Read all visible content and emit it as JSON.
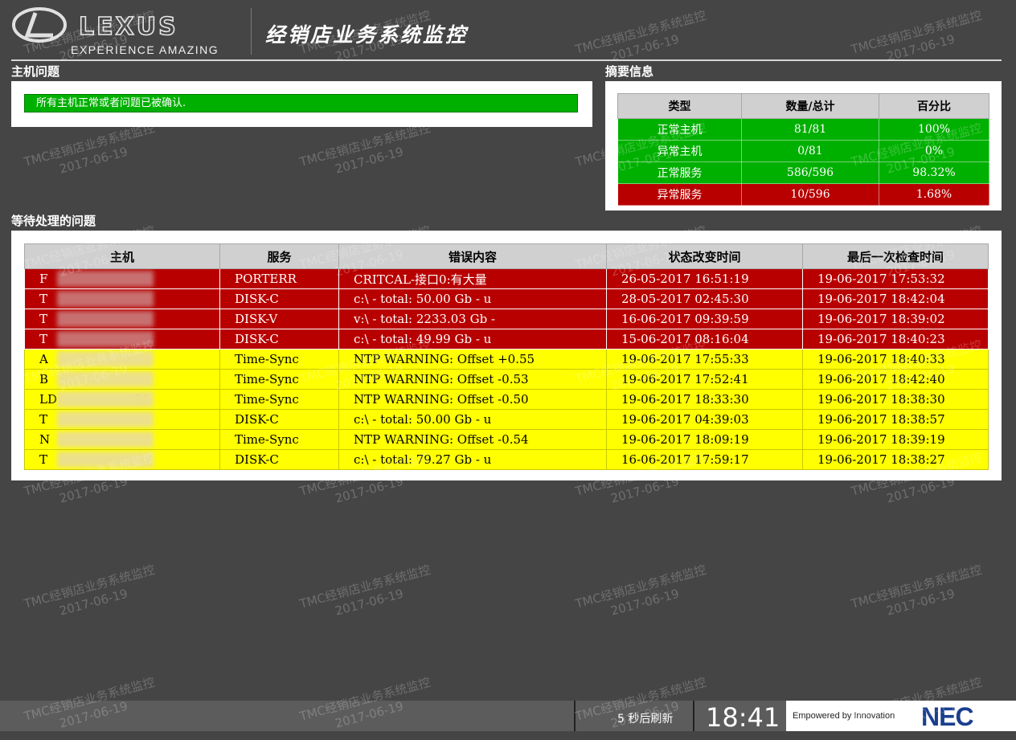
{
  "header": {
    "brand_word": "LEXUS",
    "brand_tagline": "EXPERIENCE AMAZING",
    "system_title": "经销店业务系统监控"
  },
  "host_issues": {
    "title": "主机问题",
    "status_message": "所有主机正常或者问题已被确认."
  },
  "summary": {
    "title": "摘要信息",
    "columns": [
      "类型",
      "数量/总计",
      "百分比"
    ],
    "rows": [
      {
        "type": "正常主机",
        "count": "81/81",
        "percent": "100%",
        "status": "green"
      },
      {
        "type": "异常主机",
        "count": "0/81",
        "percent": "0%",
        "status": "green"
      },
      {
        "type": "正常服务",
        "count": "586/596",
        "percent": "98.32%",
        "status": "green"
      },
      {
        "type": "异常服务",
        "count": "10/596",
        "percent": "1.68%",
        "status": "red"
      }
    ]
  },
  "pending": {
    "title": "等待处理的问题",
    "columns": [
      "主机",
      "服务",
      "错误内容",
      "状态改变时间",
      "最后一次检查时间"
    ],
    "rows": [
      {
        "host": "F",
        "service": "PORTERR",
        "error": "CRITCAL-接口0:有大量",
        "changed": "26-05-2017 16:51:19",
        "checked": "19-06-2017 17:53:32",
        "severity": "critical"
      },
      {
        "host": "T",
        "service": "DISK-C",
        "error": "c:\\ - total: 50.00 Gb - u",
        "changed": "28-05-2017 02:45:30",
        "checked": "19-06-2017 18:42:04",
        "severity": "critical"
      },
      {
        "host": "T",
        "service": "DISK-V",
        "error": "v:\\ - total: 2233.03 Gb -",
        "changed": "16-06-2017 09:39:59",
        "checked": "19-06-2017 18:39:02",
        "severity": "critical"
      },
      {
        "host": "T",
        "service": "DISK-C",
        "error": "c:\\ - total: 49.99 Gb - u",
        "changed": "15-06-2017 08:16:04",
        "checked": "19-06-2017 18:40:23",
        "severity": "critical"
      },
      {
        "host": "A",
        "service": "Time-Sync",
        "error": "NTP WARNING: Offset +0.55",
        "changed": "19-06-2017 17:55:33",
        "checked": "19-06-2017 18:40:33",
        "severity": "warning"
      },
      {
        "host": "B",
        "service": "Time-Sync",
        "error": "NTP WARNING: Offset -0.53",
        "changed": "19-06-2017 17:52:41",
        "checked": "19-06-2017 18:42:40",
        "severity": "warning"
      },
      {
        "host": "LD                    31",
        "service": "Time-Sync",
        "error": "NTP WARNING: Offset -0.50",
        "changed": "19-06-2017 18:33:30",
        "checked": "19-06-2017 18:38:30",
        "severity": "warning"
      },
      {
        "host": "T",
        "service": "DISK-C",
        "error": "c:\\ - total: 50.00 Gb - u",
        "changed": "19-06-2017 04:39:03",
        "checked": "19-06-2017 18:38:57",
        "severity": "warning"
      },
      {
        "host": "N",
        "service": "Time-Sync",
        "error": "NTP WARNING: Offset -0.54",
        "changed": "19-06-2017 18:09:19",
        "checked": "19-06-2017 18:39:19",
        "severity": "warning"
      },
      {
        "host": "T",
        "service": "DISK-C",
        "error": "c:\\ - total: 79.27 Gb - u",
        "changed": "16-06-2017 17:59:17",
        "checked": "19-06-2017 18:38:27",
        "severity": "warning"
      }
    ]
  },
  "footer": {
    "refresh_text": "5 秒后刷新",
    "clock": "18:41",
    "brand_tagline": "Empowered by Innovation",
    "brand_logo": "NEC"
  },
  "watermark": {
    "line1": "TMC经销店业务系统监控",
    "line2": "2017-06-19"
  },
  "colors": {
    "ok": "#00b000",
    "critical": "#b80000",
    "warning": "#ffff00",
    "background": "#454545"
  }
}
